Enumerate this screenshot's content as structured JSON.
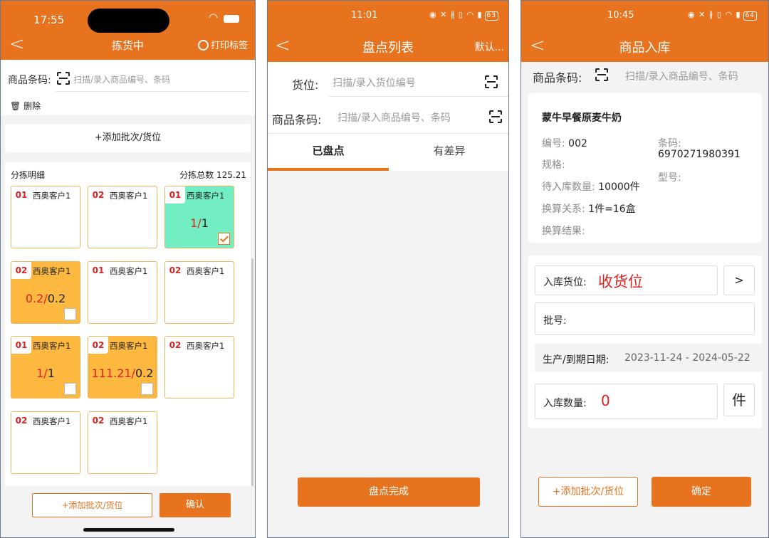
{
  "screen1": {
    "time": "17:55",
    "title": "拣货中",
    "print_label": "打印标签",
    "barcode_label": "商品条码:",
    "barcode_placeholder": "扫描/录入商品编号、条码",
    "delete_label": "删除",
    "add_batch": "+添加批次/货位",
    "detail_title": "分拣明细",
    "total_label": "分拣总数 125.21",
    "cells": [
      {
        "num": "01",
        "customer": "西奥客户1",
        "qty_red": "",
        "qty_black": "",
        "state": "empty"
      },
      {
        "num": "02",
        "customer": "西奥客户1",
        "qty_red": "",
        "qty_black": "",
        "state": "empty"
      },
      {
        "num": "01",
        "customer": "西奥客户1",
        "qty_red": "1/",
        "qty_black": "1",
        "state": "green"
      },
      {
        "num": "02",
        "customer": "西奥客户1",
        "qty_red": "0.2/",
        "qty_black": "0.2",
        "state": "amber"
      },
      {
        "num": "01",
        "customer": "西奥客户1",
        "qty_red": "",
        "qty_black": "",
        "state": "empty"
      },
      {
        "num": "02",
        "customer": "西奥客户1",
        "qty_red": "",
        "qty_black": "",
        "state": "empty"
      },
      {
        "num": "01",
        "customer": "西奥客户1",
        "qty_red": "1/",
        "qty_black": "1",
        "state": "amber"
      },
      {
        "num": "02",
        "customer": "西奥客户1",
        "qty_red": "111.21/",
        "qty_black": "0.2",
        "state": "amber"
      },
      {
        "num": "02",
        "customer": "西奥客户1",
        "qty_red": "",
        "qty_black": "",
        "state": "empty"
      },
      {
        "num": "02",
        "customer": "西奥客户1",
        "qty_red": "",
        "qty_black": "",
        "state": "empty"
      },
      {
        "num": "02",
        "customer": "西奥客户1",
        "qty_red": "",
        "qty_black": "",
        "state": "empty"
      }
    ],
    "footer_add": "+添加批次/货位",
    "confirm": "确认"
  },
  "screen2": {
    "time": "11:01",
    "status_icons": "◉ ✕ ∦ ▯ ◠ ▮",
    "battery": "63",
    "title": "盘点列表",
    "right_action": "默认...",
    "location_label": "货位:",
    "location_placeholder": "扫描/录入货位编号",
    "barcode_label": "商品条码:",
    "barcode_placeholder": "扫描/录入商品编号、条码",
    "tabs": [
      "已盘点",
      "有差异"
    ],
    "finish": "盘点完成"
  },
  "screen3": {
    "time": "10:45",
    "status_icons": "◉ ✕ ∦ ▯ ◠ ▮",
    "battery": "64",
    "title": "商品入库",
    "barcode_label": "商品条码:",
    "barcode_placeholder": "扫描/录入商品编号、条码",
    "product_name": "蒙牛早餐原麦牛奶",
    "code_label": "编号:",
    "code_value": "002",
    "barcode2_label": "条码:",
    "barcode2_value": "6970271980391",
    "spec_label": "规格:",
    "model_label": "型号:",
    "pending_label": "待入库数量:",
    "pending_value": "10000件",
    "conversion_label": "换算关系:",
    "conversion_value": "1件=16盒",
    "conversion_result_label": "换算结果:",
    "location_label": "入库货位:",
    "location_value": "收货位",
    "arrow": ">",
    "batch_label": "批号:",
    "date_label": "生产/到期日期:",
    "date_value": "2023-11-24 - 2024-05-22",
    "qty_label": "入库数量:",
    "qty_value": "0",
    "unit": "件",
    "add_batch": "+添加批次/货位",
    "confirm": "确定"
  }
}
